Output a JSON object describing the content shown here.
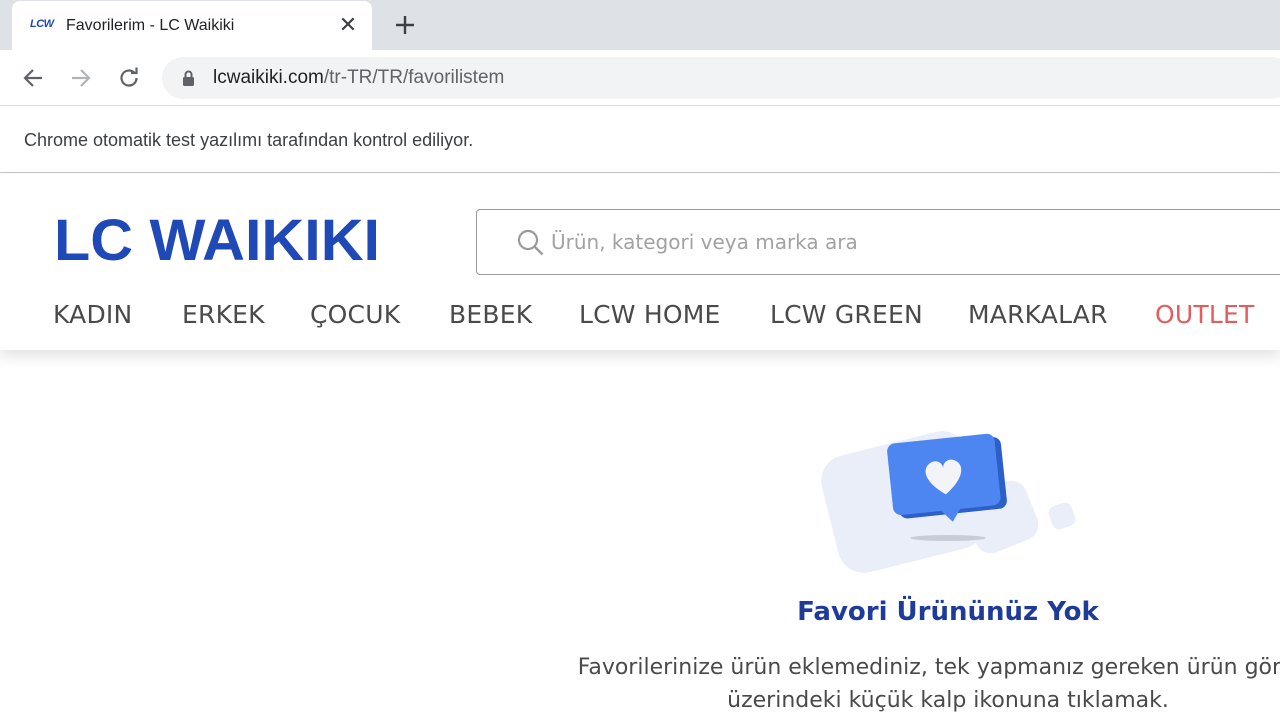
{
  "browser": {
    "tab": {
      "title": "Favorilerim - LC Waikiki",
      "favicon_text": "LCW"
    },
    "url_host": "lcwaikiki.com",
    "url_path": "/tr-TR/TR/favorilistem",
    "infobar_text": "Chrome otomatik test yazılımı tarafından kontrol ediliyor."
  },
  "site": {
    "logo_text": "LC WAIKIKI",
    "search": {
      "placeholder": "Ürün, kategori veya marka ara",
      "value": ""
    },
    "nav": [
      {
        "label": "KADIN"
      },
      {
        "label": "ERKEK"
      },
      {
        "label": "ÇOCUK"
      },
      {
        "label": "BEBEK"
      },
      {
        "label": "LCW HOME"
      },
      {
        "label": "LCW GREEN"
      },
      {
        "label": "MARKALAR"
      },
      {
        "label": "OUTLET"
      }
    ]
  },
  "empty_state": {
    "title": "Favori Ürününüz Yok",
    "line1": "Favorilerinize ürün eklemediniz, tek yapmanız gereken ürün görseli",
    "line2": "üzerindeki küçük kalp ikonuna tıklamak."
  },
  "colors": {
    "brand_blue": "#1f49b6",
    "title_blue": "#1e3b9a",
    "outlet_red": "#e35d5d",
    "heart_bubble": "#4d86f0"
  }
}
